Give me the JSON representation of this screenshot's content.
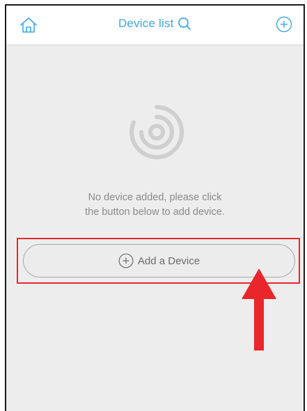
{
  "header": {
    "title": "Device list",
    "home_icon": "home-icon",
    "search_icon": "search-icon",
    "add_icon": "plus-circle-icon"
  },
  "empty_state": {
    "logo_icon": "ring-logo-icon",
    "message_line1": "No device added, please click",
    "message_line2": "the button below to add device."
  },
  "add_device": {
    "label": "Add a Device",
    "icon": "plus-circle-icon"
  },
  "annotation": {
    "highlight_color": "#e8262b",
    "arrow_icon": "up-arrow-icon"
  },
  "colors": {
    "accent": "#3aa8e0",
    "background": "#ededed",
    "text_muted": "#8a8a8a"
  }
}
